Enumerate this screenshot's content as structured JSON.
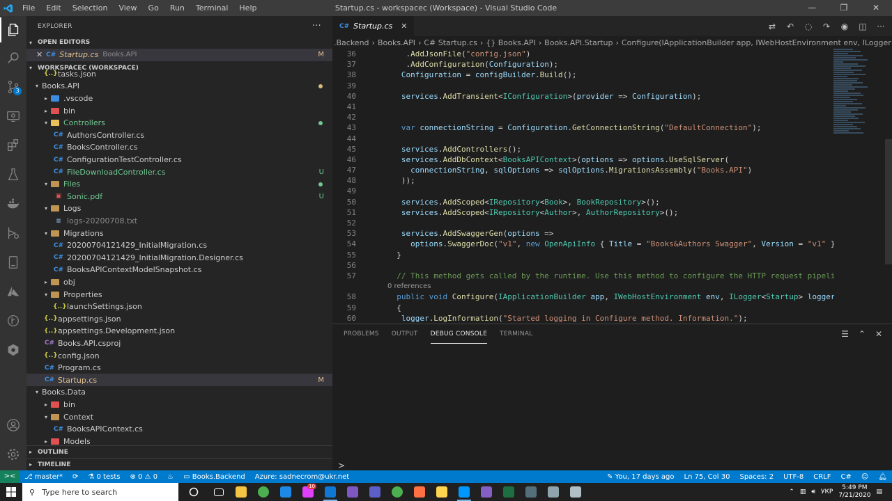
{
  "window": {
    "title": "Startup.cs - workspacec (Workspace) - Visual Studio Code",
    "menu": [
      "File",
      "Edit",
      "Selection",
      "View",
      "Go",
      "Run",
      "Terminal",
      "Help"
    ]
  },
  "activity": {
    "source_control_badge": "3"
  },
  "sidebar": {
    "title": "EXPLORER",
    "open_editors_label": "OPEN EDITORS",
    "open_editor": {
      "name": "Startup.cs",
      "folder": "Books.API",
      "status": "M"
    },
    "workspace_label": "WORKSPACEC (WORKSPACE)",
    "tree": [
      {
        "name": "tasks.json",
        "type": "json",
        "depth": 1,
        "chev": ""
      },
      {
        "name": "Books.API",
        "type": "folder",
        "depth": 0,
        "chev": "open",
        "dot": "#d7ba7d"
      },
      {
        "name": ".vscode",
        "type": "folder",
        "depth": 1,
        "chev": "closed",
        "color": "#3d8ee0"
      },
      {
        "name": "bin",
        "type": "folder",
        "depth": 1,
        "chev": "closed",
        "color": "#e05151"
      },
      {
        "name": "Controllers",
        "type": "folder",
        "depth": 1,
        "chev": "open",
        "color": "#e8c05a",
        "green": true,
        "dot": "#73c991"
      },
      {
        "name": "AuthorsController.cs",
        "type": "cs",
        "depth": 2,
        "chev": ""
      },
      {
        "name": "BooksController.cs",
        "type": "cs",
        "depth": 2,
        "chev": ""
      },
      {
        "name": "ConfigurationTestController.cs",
        "type": "cs",
        "depth": 2,
        "chev": ""
      },
      {
        "name": "FileDownloadController.cs",
        "type": "cs",
        "depth": 2,
        "chev": "",
        "green": true,
        "status": "U"
      },
      {
        "name": "Files",
        "type": "folder",
        "depth": 1,
        "chev": "open",
        "color": "#c09553",
        "green": true,
        "dot": "#73c991"
      },
      {
        "name": "Sonic.pdf",
        "type": "pdf",
        "depth": 2,
        "chev": "",
        "green": true,
        "status": "U"
      },
      {
        "name": "Logs",
        "type": "folder",
        "depth": 1,
        "chev": "open",
        "color": "#c09553"
      },
      {
        "name": "logs-20200708.txt",
        "type": "txt",
        "depth": 2,
        "chev": "",
        "dim": true
      },
      {
        "name": "Migrations",
        "type": "folder",
        "depth": 1,
        "chev": "open",
        "color": "#c09553"
      },
      {
        "name": "20200704121429_InitialMigration.cs",
        "type": "cs",
        "depth": 2,
        "chev": ""
      },
      {
        "name": "20200704121429_InitialMigration.Designer.cs",
        "type": "cs",
        "depth": 2,
        "chev": ""
      },
      {
        "name": "BooksAPIContextModelSnapshot.cs",
        "type": "cs",
        "depth": 2,
        "chev": ""
      },
      {
        "name": "obj",
        "type": "folder",
        "depth": 1,
        "chev": "closed",
        "color": "#c09553"
      },
      {
        "name": "Properties",
        "type": "folder",
        "depth": 1,
        "chev": "open",
        "color": "#c09553"
      },
      {
        "name": "launchSettings.json",
        "type": "json",
        "depth": 2,
        "chev": ""
      },
      {
        "name": "appsettings.json",
        "type": "json",
        "depth": 1,
        "chev": ""
      },
      {
        "name": "appsettings.Development.json",
        "type": "json",
        "depth": 1,
        "chev": ""
      },
      {
        "name": "Books.API.csproj",
        "type": "proj",
        "depth": 1,
        "chev": ""
      },
      {
        "name": "config.json",
        "type": "json",
        "depth": 1,
        "chev": ""
      },
      {
        "name": "Program.cs",
        "type": "cs",
        "depth": 1,
        "chev": ""
      },
      {
        "name": "Startup.cs",
        "type": "cs",
        "depth": 1,
        "chev": "",
        "mod": true,
        "status": "M",
        "selected": true
      },
      {
        "name": "Books.Data",
        "type": "folder",
        "depth": 0,
        "chev": "open"
      },
      {
        "name": "bin",
        "type": "folder",
        "depth": 1,
        "chev": "closed",
        "color": "#e05151"
      },
      {
        "name": "Context",
        "type": "folder",
        "depth": 1,
        "chev": "open",
        "color": "#c09553"
      },
      {
        "name": "BooksAPIContext.cs",
        "type": "cs",
        "depth": 2,
        "chev": ""
      },
      {
        "name": "Models",
        "type": "folder",
        "depth": 1,
        "chev": "closed",
        "color": "#e05151"
      }
    ],
    "outline_label": "OUTLINE",
    "timeline_label": "TIMELINE"
  },
  "editor": {
    "tab": {
      "name": "Startup.cs",
      "lang": "C#"
    },
    "breadcrumb": [
      ".Backend",
      "Books.API",
      "C# Startup.cs",
      "{} Books.API",
      "Books.API.Startup",
      "Configure(IApplicationBuilder app, IWebHostEnvironment env, ILogger<Startup> logger)"
    ],
    "codelens": "0 references",
    "codelens_before_line": "58",
    "lines": [
      {
        "n": "36",
        "tokens": [
          [
            "p",
            "    ."
          ],
          [
            "fn",
            "AddJsonFile"
          ],
          [
            "p",
            "("
          ],
          [
            "str",
            "\"config.json\""
          ],
          [
            "p",
            ")"
          ]
        ]
      },
      {
        "n": "37",
        "tokens": [
          [
            "p",
            "    ."
          ],
          [
            "fn",
            "AddConfiguration"
          ],
          [
            "p",
            "("
          ],
          [
            "var",
            "Configuration"
          ],
          [
            "p",
            ");"
          ]
        ]
      },
      {
        "n": "38",
        "tokens": [
          [
            "var",
            "   Configuration"
          ],
          [
            "p",
            " = "
          ],
          [
            "var",
            "configBuilder"
          ],
          [
            "p",
            "."
          ],
          [
            "fn",
            "Build"
          ],
          [
            "p",
            "();"
          ]
        ]
      },
      {
        "n": "39",
        "tokens": []
      },
      {
        "n": "40",
        "tokens": [
          [
            "var",
            "   services"
          ],
          [
            "p",
            "."
          ],
          [
            "fn",
            "AddTransient"
          ],
          [
            "p",
            "<"
          ],
          [
            "ty",
            "IConfiguration"
          ],
          [
            "p",
            ">("
          ],
          [
            "var",
            "provider"
          ],
          [
            "p",
            " => "
          ],
          [
            "var",
            "Configuration"
          ],
          [
            "p",
            ");"
          ]
        ]
      },
      {
        "n": "41",
        "tokens": []
      },
      {
        "n": "42",
        "tokens": []
      },
      {
        "n": "43",
        "tokens": [
          [
            "kw",
            "   var"
          ],
          [
            "p",
            " "
          ],
          [
            "var",
            "connectionString"
          ],
          [
            "p",
            " = "
          ],
          [
            "var",
            "Configuration"
          ],
          [
            "p",
            "."
          ],
          [
            "fn",
            "GetConnectionString"
          ],
          [
            "p",
            "("
          ],
          [
            "str",
            "\"DefaultConnection\""
          ],
          [
            "p",
            ");"
          ]
        ]
      },
      {
        "n": "44",
        "tokens": []
      },
      {
        "n": "45",
        "tokens": [
          [
            "var",
            "   services"
          ],
          [
            "p",
            "."
          ],
          [
            "fn",
            "AddControllers"
          ],
          [
            "p",
            "();"
          ]
        ]
      },
      {
        "n": "46",
        "tokens": [
          [
            "var",
            "   services"
          ],
          [
            "p",
            "."
          ],
          [
            "fn",
            "AddDbContext"
          ],
          [
            "p",
            "<"
          ],
          [
            "ty",
            "BooksAPIContext"
          ],
          [
            "p",
            ">("
          ],
          [
            "var",
            "options"
          ],
          [
            "p",
            " => "
          ],
          [
            "var",
            "options"
          ],
          [
            "p",
            "."
          ],
          [
            "fn",
            "UseSqlServer"
          ],
          [
            "p",
            "("
          ]
        ]
      },
      {
        "n": "47",
        "tokens": [
          [
            "var",
            "     connectionString"
          ],
          [
            "p",
            ", "
          ],
          [
            "var",
            "sqlOptions"
          ],
          [
            "p",
            " => "
          ],
          [
            "var",
            "sqlOptions"
          ],
          [
            "p",
            "."
          ],
          [
            "fn",
            "MigrationsAssembly"
          ],
          [
            "p",
            "("
          ],
          [
            "str",
            "\"Books.API\""
          ],
          [
            "p",
            ")"
          ]
        ]
      },
      {
        "n": "48",
        "tokens": [
          [
            "p",
            "   ));"
          ]
        ]
      },
      {
        "n": "49",
        "tokens": []
      },
      {
        "n": "50",
        "tokens": [
          [
            "var",
            "   services"
          ],
          [
            "p",
            "."
          ],
          [
            "fn",
            "AddScoped"
          ],
          [
            "p",
            "<"
          ],
          [
            "ty",
            "IRepository"
          ],
          [
            "p",
            "<"
          ],
          [
            "ty",
            "Book"
          ],
          [
            "p",
            ">, "
          ],
          [
            "ty",
            "BookRepository"
          ],
          [
            "p",
            ">();"
          ]
        ]
      },
      {
        "n": "51",
        "tokens": [
          [
            "var",
            "   services"
          ],
          [
            "p",
            "."
          ],
          [
            "fn",
            "AddScoped"
          ],
          [
            "p",
            "<"
          ],
          [
            "ty",
            "IRepository"
          ],
          [
            "p",
            "<"
          ],
          [
            "ty",
            "Author"
          ],
          [
            "p",
            ">, "
          ],
          [
            "ty",
            "AuthorRepository"
          ],
          [
            "p",
            ">();"
          ]
        ]
      },
      {
        "n": "52",
        "tokens": []
      },
      {
        "n": "53",
        "tokens": [
          [
            "var",
            "   services"
          ],
          [
            "p",
            "."
          ],
          [
            "fn",
            "AddSwaggerGen"
          ],
          [
            "p",
            "("
          ],
          [
            "var",
            "options"
          ],
          [
            "p",
            " =>"
          ]
        ]
      },
      {
        "n": "54",
        "tokens": [
          [
            "var",
            "     options"
          ],
          [
            "p",
            "."
          ],
          [
            "fn",
            "SwaggerDoc"
          ],
          [
            "p",
            "("
          ],
          [
            "str",
            "\"v1\""
          ],
          [
            "p",
            ", "
          ],
          [
            "kw",
            "new"
          ],
          [
            "p",
            " "
          ],
          [
            "ty",
            "OpenApiInfo"
          ],
          [
            "p",
            " { "
          ],
          [
            "var",
            "Title"
          ],
          [
            "p",
            " = "
          ],
          [
            "str",
            "\"Books&Authors Swagger\""
          ],
          [
            "p",
            ", "
          ],
          [
            "var",
            "Version"
          ],
          [
            "p",
            " = "
          ],
          [
            "str",
            "\"v1\""
          ],
          [
            "p",
            " }));"
          ]
        ]
      },
      {
        "n": "55",
        "tokens": [
          [
            "p",
            "  }"
          ]
        ]
      },
      {
        "n": "56",
        "tokens": []
      },
      {
        "n": "57",
        "tokens": [
          [
            "cm",
            "  // This method gets called by the runtime. Use this method to configure the HTTP request pipeline."
          ]
        ]
      },
      {
        "n": "58",
        "tokens": [
          [
            "kw",
            "  public"
          ],
          [
            "p",
            " "
          ],
          [
            "kw",
            "void"
          ],
          [
            "p",
            " "
          ],
          [
            "fn",
            "Configure"
          ],
          [
            "p",
            "("
          ],
          [
            "ty",
            "IApplicationBuilder"
          ],
          [
            "p",
            " "
          ],
          [
            "var",
            "app"
          ],
          [
            "p",
            ", "
          ],
          [
            "ty",
            "IWebHostEnvironment"
          ],
          [
            "p",
            " "
          ],
          [
            "var",
            "env"
          ],
          [
            "p",
            ", "
          ],
          [
            "ty",
            "ILogger"
          ],
          [
            "p",
            "<"
          ],
          [
            "ty",
            "Startup"
          ],
          [
            "p",
            "> "
          ],
          [
            "var",
            "logger"
          ],
          [
            "p",
            ")"
          ]
        ]
      },
      {
        "n": "59",
        "tokens": [
          [
            "p",
            "  {"
          ]
        ]
      },
      {
        "n": "60",
        "tokens": [
          [
            "var",
            "   logger"
          ],
          [
            "p",
            "."
          ],
          [
            "fn",
            "LogInformation"
          ],
          [
            "p",
            "("
          ],
          [
            "str",
            "\"Started logging in Configure method. Information.\""
          ],
          [
            "p",
            ");"
          ]
        ]
      }
    ]
  },
  "panel": {
    "tabs": [
      "PROBLEMS",
      "OUTPUT",
      "DEBUG CONSOLE",
      "TERMINAL"
    ],
    "active_tab": "DEBUG CONSOLE",
    "prompt": ">"
  },
  "statusbar": {
    "remote": "><",
    "branch": "master*",
    "sync": "⟳",
    "tests": "0 tests",
    "errors": "0",
    "warnings": "0",
    "project": "Books.Backend",
    "azure": "Azure: sadnecrom@ukr.net",
    "blame": "You, 17 days ago",
    "position": "Ln 75, Col 30",
    "spaces": "Spaces: 2",
    "encoding": "UTF-8",
    "eol": "CRLF",
    "language": "C#"
  },
  "taskbar": {
    "search_placeholder": "Type here to search",
    "icons": [
      {
        "name": "task-view",
        "color": "#ffffff"
      },
      {
        "name": "explorer",
        "color": "#f4c542"
      },
      {
        "name": "chrome",
        "color": "#4caf50"
      },
      {
        "name": "app-blue",
        "color": "#1e88e5"
      },
      {
        "name": "app-pink",
        "color": "#e040fb",
        "badge": "10"
      },
      {
        "name": "outlook",
        "color": "#0f78d4",
        "running": true
      },
      {
        "name": "app-purple",
        "color": "#7e57c2"
      },
      {
        "name": "teams",
        "color": "#5b5fc7"
      },
      {
        "name": "chrome-2",
        "color": "#4caf50"
      },
      {
        "name": "app-orange",
        "color": "#ff7043"
      },
      {
        "name": "tool-yellow",
        "color": "#ffd54f"
      },
      {
        "name": "vscode",
        "color": "#0098ff",
        "running": true
      },
      {
        "name": "visual-studio",
        "color": "#865fc5"
      },
      {
        "name": "excel",
        "color": "#1d6f42"
      },
      {
        "name": "app-dark",
        "color": "#546e7a"
      },
      {
        "name": "app-grey",
        "color": "#90a4ae"
      },
      {
        "name": "app-light",
        "color": "#b0bec5"
      }
    ],
    "lang": "УКР",
    "time": "5:49 PM",
    "date": "7/21/2020"
  }
}
